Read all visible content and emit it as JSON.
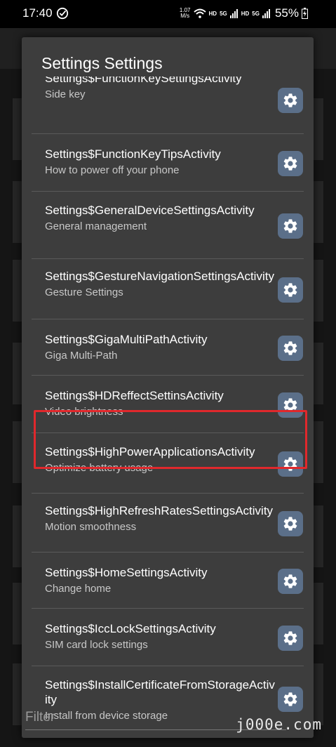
{
  "status_bar": {
    "time": "17:40",
    "speed_value": "1.07",
    "speed_unit": "M/s",
    "hd1": "HD",
    "net1": "5G",
    "hd2": "HD",
    "net2": "5G",
    "battery": "55%"
  },
  "dialog": {
    "title": "Settings Settings",
    "items": [
      {
        "title": "Settings$FunctionKeySettingsActivity",
        "subtitle": "Side key"
      },
      {
        "title": "Settings$FunctionKeyTipsActivity",
        "subtitle": "How to power off your phone"
      },
      {
        "title": "Settings$GeneralDeviceSettingsActivity",
        "subtitle": "General management"
      },
      {
        "title": "Settings$GestureNavigationSettingsActivity",
        "subtitle": "Gesture Settings"
      },
      {
        "title": "Settings$GigaMultiPathActivity",
        "subtitle": "Giga Multi-Path"
      },
      {
        "title": "Settings$HDReffectSettinsActivity",
        "subtitle": "Video brightness"
      },
      {
        "title": "Settings$HighPowerApplicationsActivity",
        "subtitle": "Optimize battery usage"
      },
      {
        "title": "Settings$HighRefreshRatesSettingsActivity",
        "subtitle": "Motion smoothness"
      },
      {
        "title": "Settings$HomeSettingsActivity",
        "subtitle": "Change home"
      },
      {
        "title": "Settings$IccLockSettingsActivity",
        "subtitle": "SIM card lock settings"
      },
      {
        "title": "Settings$InstallCertificateFromStorageActivity",
        "subtitle": "Install from device storage"
      }
    ],
    "filter_placeholder": "Filter"
  },
  "watermark": "j000e.com",
  "colors": {
    "dialog_bg": "#3d3d3d",
    "gear_button": "#5b6f89",
    "highlight": "#e0282c"
  },
  "icons": {
    "item_action": "gear-icon"
  }
}
